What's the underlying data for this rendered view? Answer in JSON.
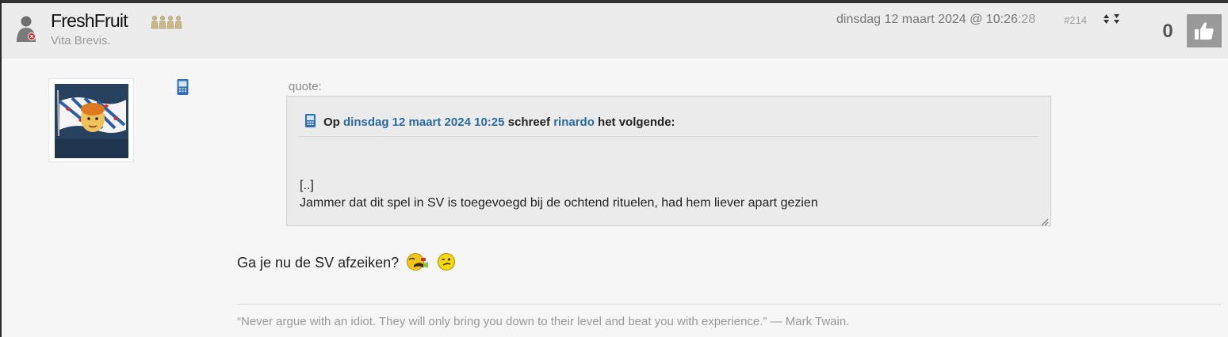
{
  "post": {
    "author": {
      "name": "FreshFruit",
      "tagline": "Vita Brevis.",
      "status_icon": "user-offline-icon",
      "rank_icon": "rank-figures-icon"
    },
    "timestamp_main": "dinsdag 12 maart 2024 @ 10:26",
    "timestamp_sec": ":28",
    "post_number": "#214",
    "score": "0",
    "like_icon": "thumbs-up-icon",
    "device_icon": "mobile-phone-icon"
  },
  "quote": {
    "label": "quote:",
    "head_prefix": "Op",
    "head_date": "dinsdag 12 maart 2024 10:25",
    "head_mid": "schreef",
    "head_user": "rinardo",
    "head_suffix": "het volgende:",
    "body_line1": "[..]",
    "body_line2": "Jammer dat dit spel in SV is toegevoegd bij de ochtend rituelen, had hem liever apart gezien"
  },
  "reply": {
    "text": "Ga je nu de SV afzeiken?",
    "smileys": [
      "vomit-smiley-icon",
      "wink-smiley-icon"
    ]
  },
  "signature": {
    "text": "“Never argue with an idiot. They will only bring you down to their level and beat you with experience.” — Mark Twain."
  },
  "colors": {
    "link": "#2c6a9e",
    "header_bg": "#ececec",
    "page_bg": "#f6f6f6",
    "like_button": "#999999"
  }
}
